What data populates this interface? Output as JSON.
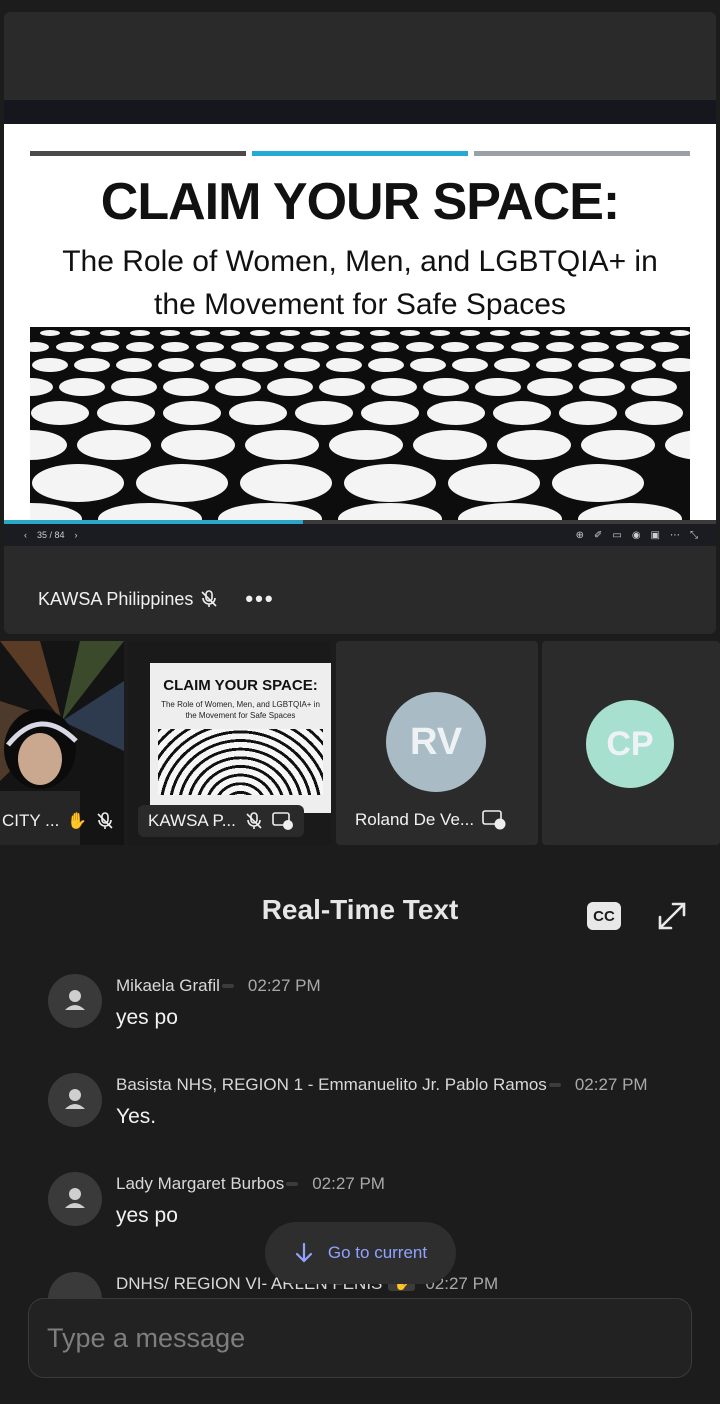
{
  "slide": {
    "title": "CLAIM YOUR SPACE:",
    "subtitle_line1": "The Role of Women, Men, and LGBTQIA+ in",
    "subtitle_line2": "the Movement for Safe Spaces",
    "bar_colors": [
      "#4a4a4a",
      "#27a9d6",
      "#9aa0a6"
    ],
    "page_indicator": "35 / 84",
    "progress": 0.42,
    "progress_color": "#2aa6c8"
  },
  "toolbar": {
    "prev_icon": "chevron-left-icon",
    "next_icon": "chevron-right-icon",
    "icons": [
      "zoom-icon",
      "pointer-icon",
      "keyboard-icon",
      "broadcast-icon",
      "layout-icon",
      "more-icon",
      "collapse-icon"
    ]
  },
  "presenter": {
    "name": "KAWSA Philippines",
    "more": "•••"
  },
  "tiles": [
    {
      "label": "CITY ..."
    },
    {
      "label": "KAWSA P...",
      "slide_title": "CLAIM YOUR SPACE:",
      "slide_sub": "The Role of Women, Men, and LGBTQIA+ in the Movement for Safe Spaces"
    },
    {
      "initials": "RV",
      "label": "Roland De Ve...",
      "color": "#a9bcc6"
    },
    {
      "initials": "CP",
      "label": "",
      "color": "#a8e0d0"
    }
  ],
  "rtt": {
    "title": "Real-Time Text",
    "cc_label": "CC"
  },
  "messages": [
    {
      "sender": "Mikaela Grafil",
      "time": "02:27 PM",
      "text": "yes po"
    },
    {
      "sender": "Basista NHS, REGION 1 - Emmanuelito Jr. Pablo Ramos",
      "time": "02:27 PM",
      "text": "Yes."
    },
    {
      "sender": "Lady Margaret Burbos",
      "time": "02:27 PM",
      "text": "yes po"
    },
    {
      "sender": "DNHS/ REGION VI- ARLEN FENIS",
      "time": "02:27 PM",
      "text": ""
    }
  ],
  "go_current": "Go to current",
  "composer": {
    "placeholder": "Type a message"
  }
}
